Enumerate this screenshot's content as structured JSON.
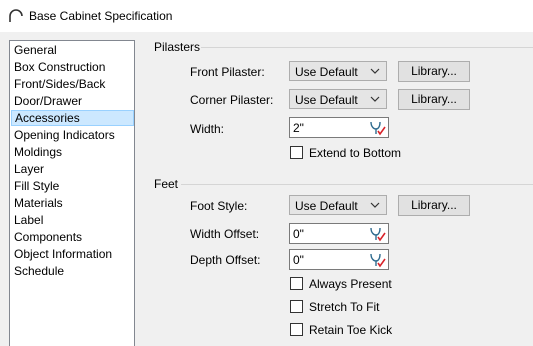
{
  "window": {
    "title": "Base Cabinet Specification",
    "icon": "cabinet-arc-icon"
  },
  "nav": {
    "selected": "Accessories",
    "items": [
      "General",
      "Box Construction",
      "Front/Sides/Back",
      "Door/Drawer",
      "Accessories",
      "Opening Indicators",
      "Moldings",
      "Layer",
      "Fill Style",
      "Materials",
      "Label",
      "Components",
      "Object Information",
      "Schedule"
    ]
  },
  "pilasters": {
    "section_label": "Pilasters",
    "front_pilaster_label": "Front Pilaster:",
    "front_pilaster_value": "Use Default",
    "corner_pilaster_label": "Corner Pilaster:",
    "corner_pilaster_value": "Use Default",
    "width_label": "Width:",
    "width_value": "2\"",
    "extend_to_bottom_label": "Extend to Bottom",
    "extend_to_bottom_checked": false
  },
  "feet": {
    "section_label": "Feet",
    "foot_style_label": "Foot Style:",
    "foot_style_value": "Use Default",
    "width_offset_label": "Width Offset:",
    "width_offset_value": "0\"",
    "depth_offset_label": "Depth Offset:",
    "depth_offset_value": "0\"",
    "always_present_label": "Always Present",
    "always_present_checked": false,
    "stretch_to_fit_label": "Stretch To Fit",
    "stretch_to_fit_checked": false,
    "retain_toe_kick_label": "Retain Toe Kick",
    "retain_toe_kick_checked": false
  },
  "common": {
    "library_label": "Library...",
    "dropdown_icon": "chevron-down-icon",
    "calculator_icon": "calculator-icon"
  },
  "colors": {
    "selection_bg": "#cce8ff",
    "selection_border": "#99d1ff",
    "dialog_bg": "#f0f0f0",
    "check_red": "#d9232a"
  }
}
